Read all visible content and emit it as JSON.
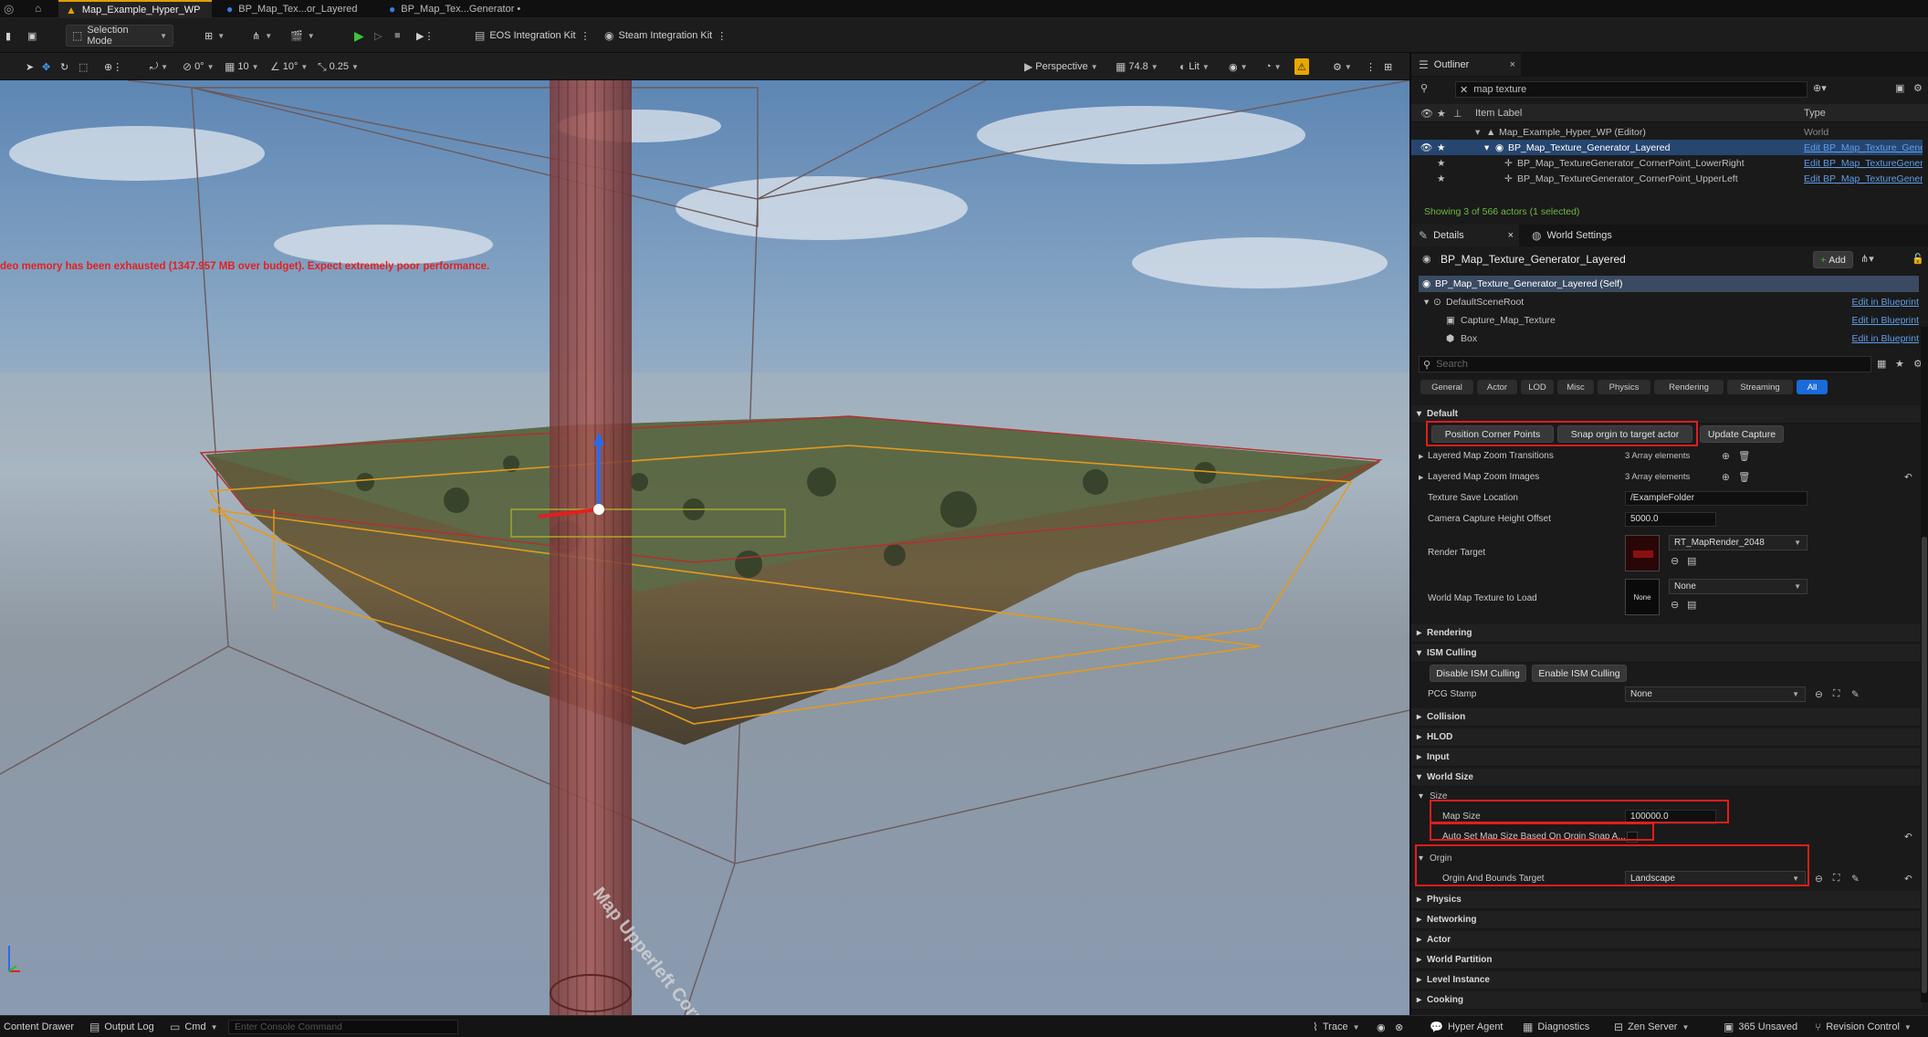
{
  "window": {
    "tabs": [
      {
        "label": "Map_Example_Hyper_WP",
        "active": true
      },
      {
        "label": "BP_Map_Tex...or_Layered",
        "active": false
      },
      {
        "label": "BP_Map_Tex...Generator •",
        "active": false
      }
    ]
  },
  "toolbar": {
    "selection_mode": "Selection Mode",
    "eos_kit": "EOS Integration Kit",
    "steam_kit": "Steam Integration Kit"
  },
  "viewport_bar": {
    "rotate_snap": "0°",
    "grid_snap": "10",
    "angle_snap": "10°",
    "scale_snap": "0.25",
    "view_mode": "Perspective",
    "fov": "74.8",
    "lighting": "Lit"
  },
  "viewport": {
    "warning": "deo memory has been exhausted (1347.957 MB over budget). Expect extremely poor performance.",
    "overlay_text": "Map Upperleft Corn"
  },
  "outliner": {
    "title": "Outliner",
    "search_value": "map texture",
    "col_label": "Item Label",
    "col_type": "Type",
    "rows": [
      {
        "label": "Map_Example_Hyper_WP (Editor)",
        "type": "World"
      },
      {
        "label": "BP_Map_Texture_Generator_Layered",
        "type": "Edit BP_Map_Texture_Generat"
      },
      {
        "label": "BP_Map_TextureGenerator_CornerPoint_LowerRight",
        "type": "Edit BP_Map_TextureGenerat"
      },
      {
        "label": "BP_Map_TextureGenerator_CornerPoint_UpperLeft",
        "type": "Edit BP_Map_TextureGenerat"
      }
    ],
    "status": "Showing 3 of 566 actors (1 selected)"
  },
  "details": {
    "tab_details": "Details",
    "tab_world": "World Settings",
    "actor_name": "BP_Map_Texture_Generator_Layered",
    "add_label": "Add",
    "components": [
      {
        "label": "BP_Map_Texture_Generator_Layered (Self)",
        "link": ""
      },
      {
        "label": "DefaultSceneRoot",
        "link": "Edit in Blueprint"
      },
      {
        "label": "Capture_Map_Texture",
        "link": "Edit in Blueprint"
      },
      {
        "label": "Box",
        "link": "Edit in Blueprint"
      }
    ],
    "search_placeholder": "Search",
    "filter_tabs": [
      "General",
      "Actor",
      "LOD",
      "Misc",
      "Physics",
      "Rendering",
      "Streaming",
      "All"
    ],
    "cat_default": "Default",
    "btn_position": "Position Corner Points",
    "btn_snap": "Snap orgin to target actor",
    "btn_update": "Update Capture",
    "zoom_transitions_label": "Layered Map Zoom Transitions",
    "zoom_transitions_value": "3 Array elements",
    "zoom_images_label": "Layered Map Zoom Images",
    "zoom_images_value": "3 Array elements",
    "save_location_label": "Texture Save Location",
    "save_location_value": "/ExampleFolder",
    "height_offset_label": "Camera Capture Height Offset",
    "height_offset_value": "5000.0",
    "render_target_label": "Render Target",
    "render_target_value": "RT_MapRender_2048",
    "world_map_label": "World Map Texture to Load",
    "world_map_value": "None",
    "world_map_thumb": "None",
    "cat_rendering": "Rendering",
    "cat_ism": "ISM Culling",
    "btn_disable_ism": "Disable ISM Culling",
    "btn_enable_ism": "Enable ISM Culling",
    "pcg_label": "PCG Stamp",
    "pcg_value": "None",
    "cat_collision": "Collision",
    "cat_hlod": "HLOD",
    "cat_input": "Input",
    "cat_world_size": "World Size",
    "sub_size": "Size",
    "map_size_label": "Map Size",
    "map_size_value": "100000.0",
    "auto_set_label": "Auto Set Map Size Based On Orgin Snap A...",
    "sub_orgin": "Orgin",
    "orgin_target_label": "Orgin And Bounds Target",
    "orgin_target_value": "Landscape",
    "cat_physics": "Physics",
    "cat_networking": "Networking",
    "cat_actor": "Actor",
    "cat_world_partition": "World Partition",
    "cat_level_instance": "Level Instance",
    "cat_cooking": "Cooking"
  },
  "statusbar": {
    "content_drawer": "Content Drawer",
    "output_log": "Output Log",
    "cmd": "Cmd",
    "console_placeholder": "Enter Console Command",
    "trace": "Trace",
    "hyper_agent": "Hyper Agent",
    "diagnostics": "Diagnostics",
    "zen_server": "Zen Server",
    "unsaved": "365 Unsaved",
    "revision_control": "Revision Control"
  }
}
